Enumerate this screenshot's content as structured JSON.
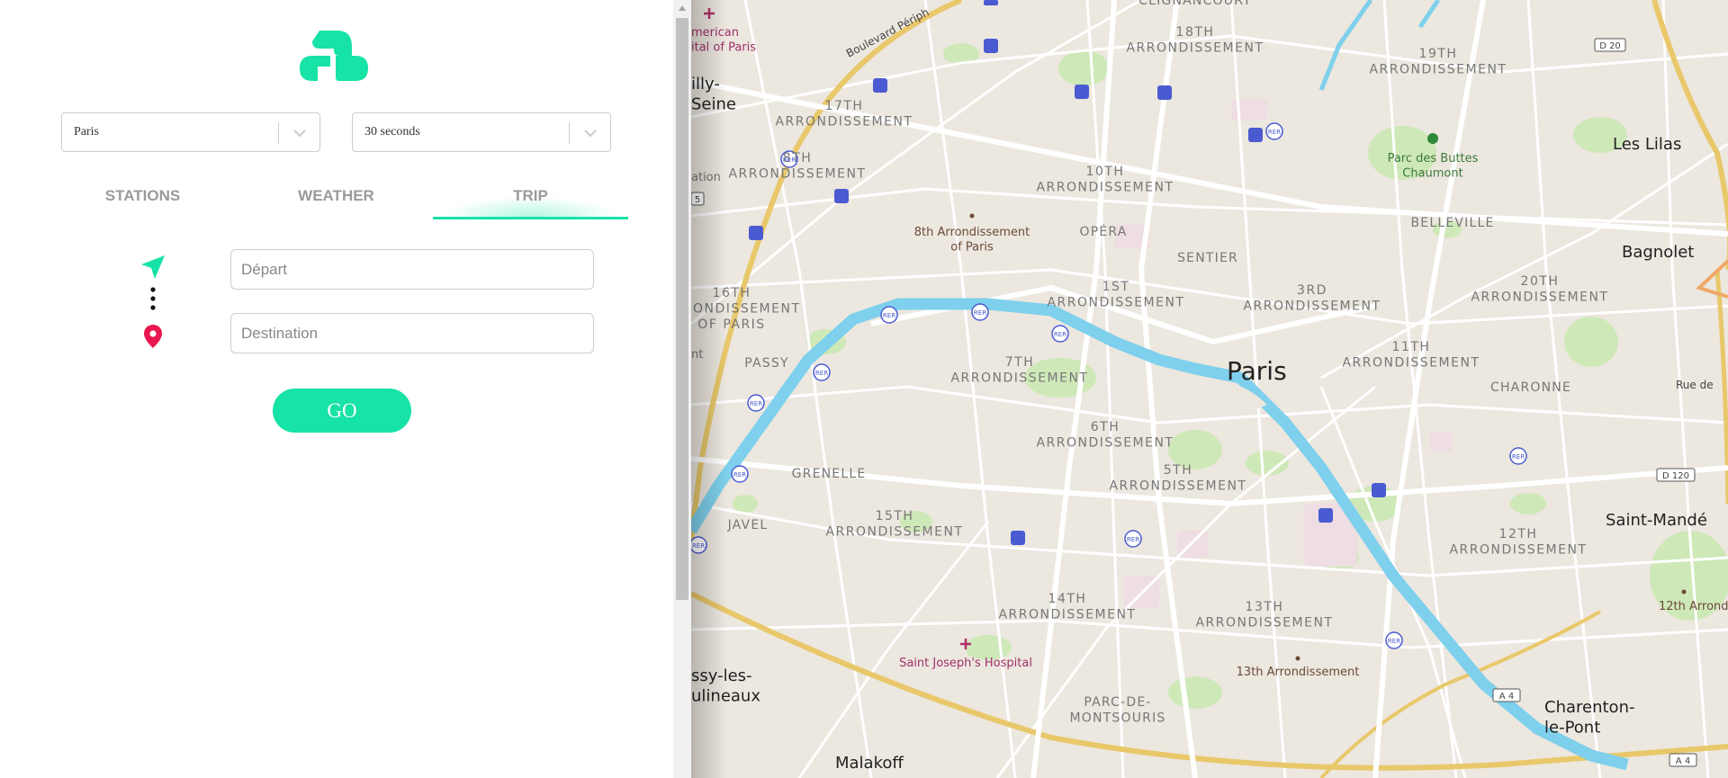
{
  "controls": {
    "city": "Paris",
    "interval": "30 seconds"
  },
  "tabs": [
    {
      "label": "STATIONS"
    },
    {
      "label": "WEATHER"
    },
    {
      "label": "TRIP"
    }
  ],
  "trip": {
    "depart_placeholder": "Départ",
    "destination_placeholder": "Destination",
    "go_label": "GO"
  },
  "colors": {
    "accent": "#17e3a6",
    "pin": "#e8174f",
    "seine": "#7ed0ec"
  },
  "map": {
    "city_label": "Paris",
    "districts": {
      "a18": "18TH\nARRONDISSEMENT",
      "a19": "19TH\nARRONDISSEMENT",
      "a17": "17TH\nARRONDISSEMENT",
      "a8": "8TH\nARRONDISSEMENT",
      "a10": "10TH\nARRONDISSEMENT",
      "a16": "16TH\nARRONDISSEMENT\nOF PARIS",
      "a1": "1ST\nARRONDISSEMENT",
      "a3": "3RD\nARRONDISSEMENT",
      "a20": "20TH\nARRONDISSEMENT",
      "a7": "7TH\nARRONDISSEMENT",
      "a11": "11TH\nARRONDISSEMENT",
      "a6": "6TH\nARRONDISSEMENT",
      "a5": "5TH\nARRONDISSEMENT",
      "a15": "15TH\nARRONDISSEMENT",
      "a12": "12TH\nARRONDISSEMENT",
      "a14": "14TH\nARRONDISSEMENT",
      "a13": "13TH\nARRONDISSEMENT"
    },
    "places": {
      "clignancourt": "CLIGNANCOURT",
      "opera": "OPÉRA",
      "sentier": "SENTIER",
      "belleville": "BELLEVILLE",
      "passy": "PASSY",
      "charonne": "CHARONNE",
      "grenelle": "GRENELLE",
      "javel": "JAVEL",
      "parc_de_montsouris": "PARC-DE-\nMONTSOURIS"
    },
    "towns": {
      "neuilly_seine": "illy-\nSeine",
      "les_lilas": "Les Lilas",
      "bagnolet": "Bagnolet",
      "saint_mande": "Saint-Mandé",
      "issy": "ssy-les-\nulineaux",
      "charenton": "Charenton-\nle-Pont",
      "malakoff": "Malakoff"
    },
    "pois": {
      "american_hospital": "merican\nital of Paris",
      "parc_buttes": "Parc des Buttes\nChaumont",
      "eighth_arr": "8th Arrondissement\nof Paris",
      "saint_joseph": "Saint Joseph's Hospital",
      "thirteenth_arr": "13th Arrondissement",
      "twelfth_arr": "12th Arrondissem",
      "station_cut": "ation",
      "nt_cut": "nt"
    },
    "roads": {
      "peripherique": "Boulevard Périph",
      "rue_de_cut": "Rue de",
      "d20": "D 20",
      "d120": "D 120",
      "a4_1": "A 4",
      "a4_2": "A 4",
      "five": "5"
    },
    "rer_label": "RER"
  }
}
